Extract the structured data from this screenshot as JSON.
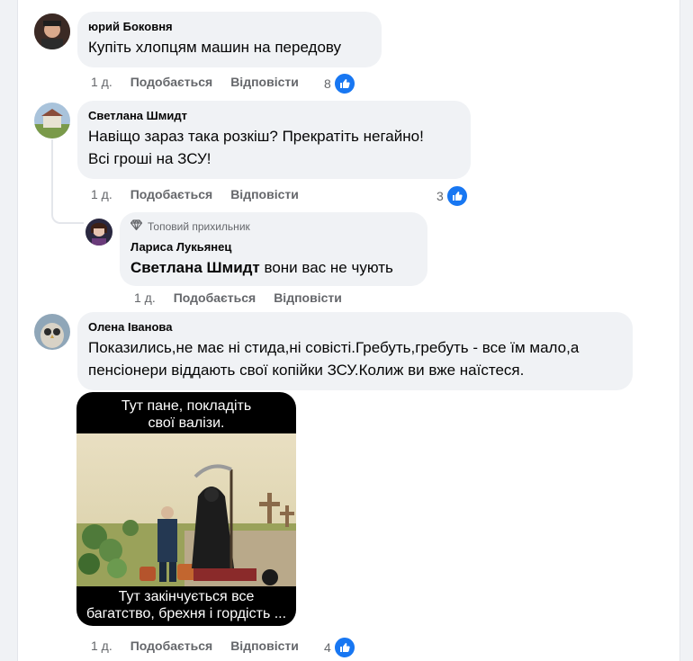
{
  "comments": [
    {
      "author": "юрий Боковня",
      "text": "Купіть хлопцям машин на передову",
      "time": "1 д.",
      "like": "Подобається",
      "reply": "Відповісти",
      "reactions": "8"
    },
    {
      "author": "Светлана Шмидт",
      "line1": "Навіщо зараз така розкіш? Прекратіть негайно!",
      "line2": "Всі гроші на ЗСУ!",
      "time": "1 д.",
      "like": "Подобається",
      "reply": "Відповісти",
      "reactions": "3"
    },
    {
      "badge": "Топовий прихильник",
      "author": "Лариса Лукьянец",
      "mention": "Светлана Шмидт",
      "text": "вони вас не чують",
      "time": "1 д.",
      "like": "Подобається",
      "reply": "Відповісти"
    },
    {
      "author": "Олена Іванова",
      "line1": "Показились,не має ні стида,ні совісті.Гребуть,гребуть - все їм мало,а",
      "line2": "пенсіонери віддають свої копійки ЗСУ.Колиж ви вже наїстеся.",
      "meme_top1": "Тут пане, покладіть",
      "meme_top2": "свої валізи.",
      "meme_bottom1": "Тут закінчується все",
      "meme_bottom2": "багатство, брехня і гордість ...",
      "time": "1 д.",
      "like": "Подобається",
      "reply": "Відповісти",
      "reactions": "4"
    }
  ],
  "colors": {
    "accent": "#1877f2",
    "bubble": "#f0f2f5",
    "muted": "#65676b"
  },
  "icons": {
    "like": "thumbs-up-icon",
    "badge": "diamond-icon"
  }
}
